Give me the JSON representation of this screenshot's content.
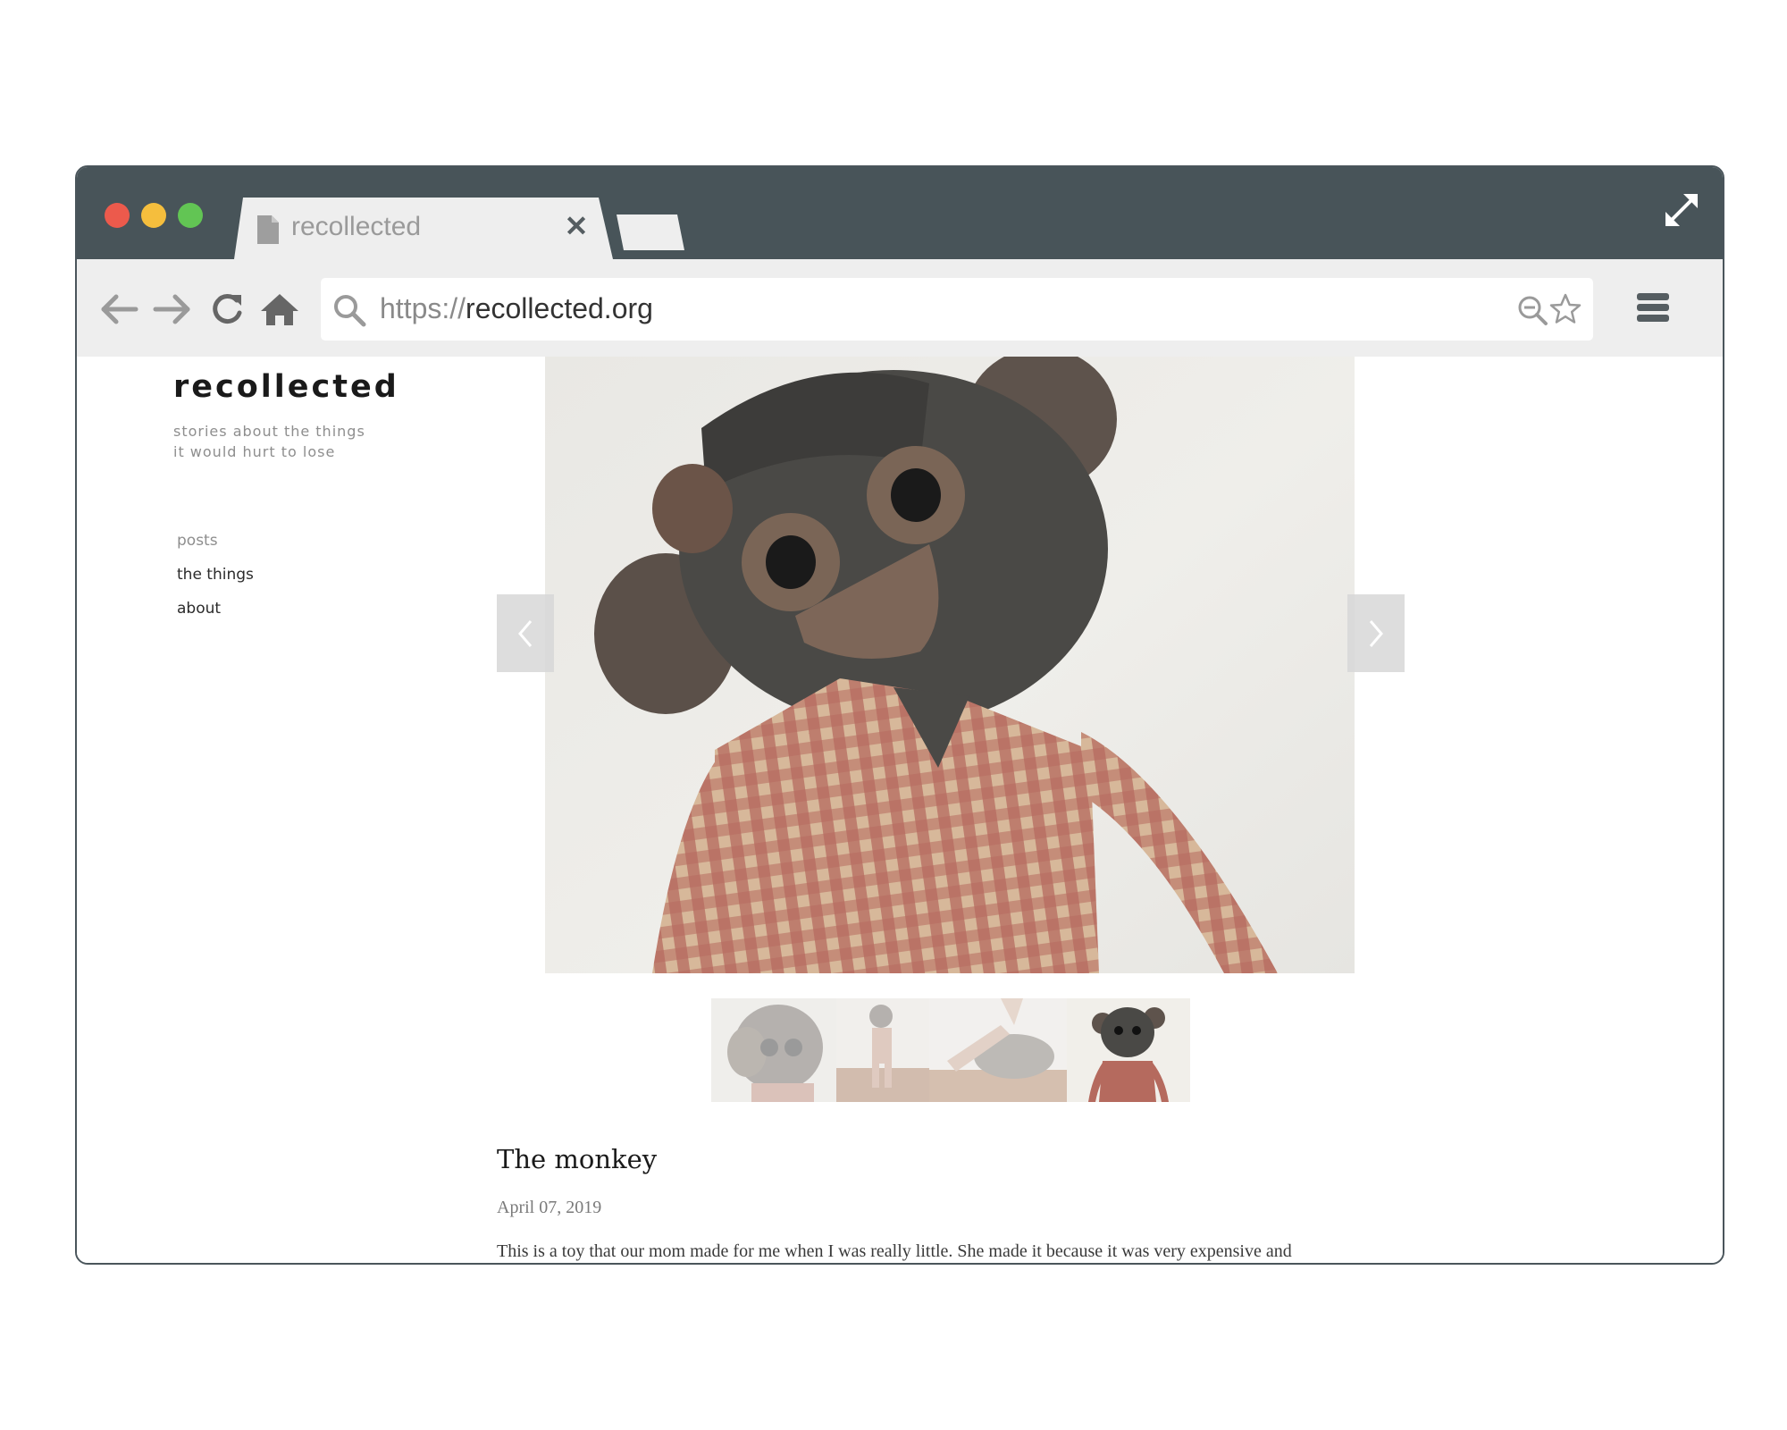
{
  "browser": {
    "tab": {
      "title": "recollected",
      "close_symbol": "✕"
    },
    "url": {
      "protocol": "https://",
      "host": "recollected.org"
    },
    "colors": {
      "titlebar": "#485459",
      "toolbar": "#eeeeee",
      "close": "#ec5a4c",
      "minimize": "#f5be3d",
      "maximize": "#62c554"
    },
    "icons": [
      "back-arrow-icon",
      "forward-arrow-icon",
      "reload-icon",
      "home-icon",
      "search-icon",
      "zoom-out-icon",
      "star-icon",
      "hamburger-menu-icon",
      "expand-icon",
      "document-icon"
    ]
  },
  "site": {
    "title": "recollected",
    "tagline": "stories about the things it would hurt to lose",
    "nav": [
      {
        "label": "posts"
      },
      {
        "label": "the things"
      },
      {
        "label": "about"
      }
    ]
  },
  "gallery": {
    "thumbnail_count": 4,
    "active_thumbnail": 4,
    "prev_icon": "chevron-left-icon",
    "next_icon": "chevron-right-icon"
  },
  "post": {
    "title": "The monkey",
    "date": "April 07, 2019",
    "body": "This is a toy that our mom made for me when I was really little. She made it because it was very expensive and"
  }
}
